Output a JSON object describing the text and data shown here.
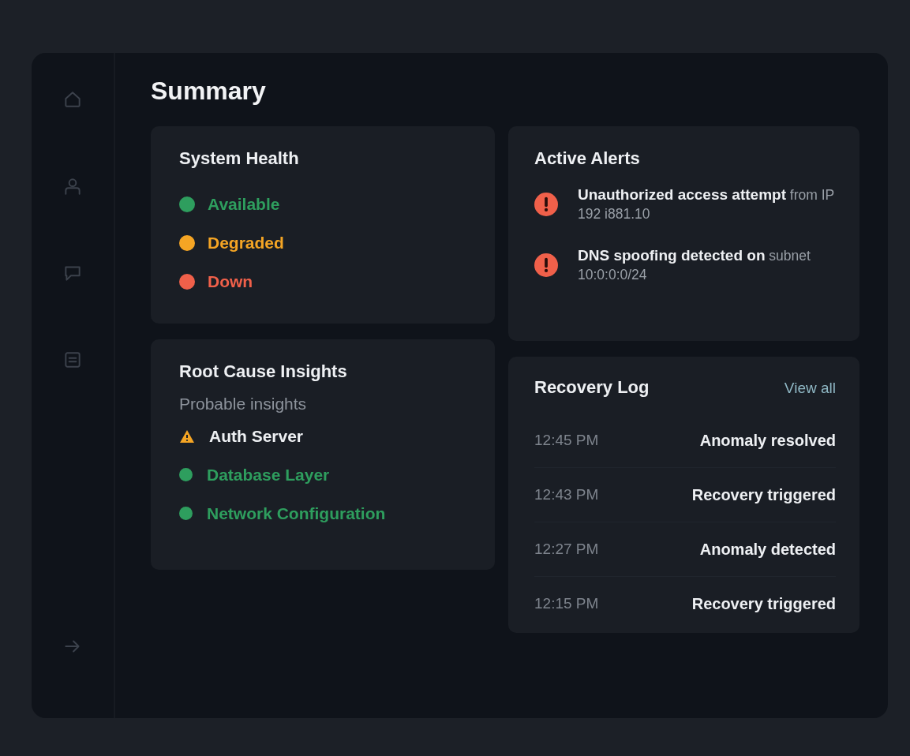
{
  "sidebar": {
    "items": [
      {
        "kind": "home"
      },
      {
        "kind": "user"
      },
      {
        "kind": "chat"
      },
      {
        "kind": "list"
      }
    ],
    "footer": {
      "kind": "arrow"
    }
  },
  "title": "Summary",
  "system_health": {
    "title": "System Health",
    "statuses": [
      {
        "label": "Available",
        "color": "#2e9e5e"
      },
      {
        "label": "Degraded",
        "color": "#f5a524"
      },
      {
        "label": "Down",
        "color": "#f0604a"
      }
    ]
  },
  "root_cause": {
    "title": "Root Cause Insights",
    "subtitle": "Probable insights",
    "items": [
      {
        "label": "Auth Server",
        "kind": "warning",
        "color": "#f5a524"
      },
      {
        "label": "Database Layer",
        "kind": "dot",
        "color": "#2e9e5e"
      },
      {
        "label": "Network Configuration",
        "kind": "dot",
        "color": "#2e9e5e"
      }
    ]
  },
  "active_alerts": {
    "title": "Active Alerts",
    "alerts": [
      {
        "text": "**Unauthorized access attempt** from IP 192 i881.10"
      },
      {
        "text": "**DNS spoofing detected on** subnet 10:0:0:0/24"
      }
    ]
  },
  "recovery_log": {
    "title": "Recovery Log",
    "link": "View all",
    "entries": [
      {
        "time": "12:45 PM",
        "event": "Anomaly resolved"
      },
      {
        "time": "12:43 PM",
        "event": "Recovery triggered"
      },
      {
        "time": "12:27 PM",
        "event": "Anomaly detected"
      },
      {
        "time": "12:15 PM",
        "event": "Recovery triggered"
      }
    ]
  }
}
